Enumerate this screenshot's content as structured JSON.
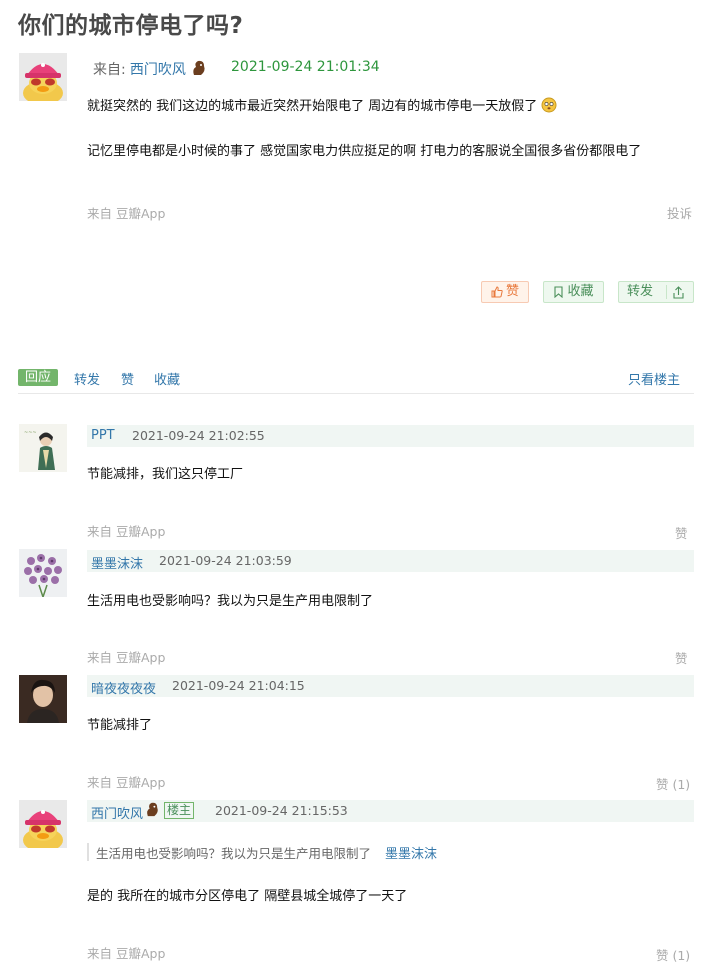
{
  "post": {
    "title": "你们的城市停电了吗?",
    "from_label": "来自:",
    "author": "西门吹风",
    "timestamp": "2021-09-24 21:01:34",
    "para1": "就挺突然的  我们这边的城市最近突然开始限电了  周边有的城市停电一天放假了",
    "para2": "记忆里停电都是小时候的事了  感觉国家电力供应挺足的啊  打电力的客服说全国很多省份都限电了",
    "source": "来自 豆瓣App",
    "report": "投诉"
  },
  "actions": {
    "like": "赞",
    "favorite": "收藏",
    "share": "转发"
  },
  "tabs": {
    "reply": "回应",
    "share": "转发",
    "like": "赞",
    "favorite": "收藏",
    "only_op": "只看楼主"
  },
  "comments": [
    {
      "name": "PPT",
      "time": "2021-09-24 21:02:55",
      "text": "节能减排，我们这只停工厂",
      "source": "来自 豆瓣App",
      "like": "赞"
    },
    {
      "name": "墨墨沫沫",
      "time": "2021-09-24 21:03:59",
      "text": "生活用电也受影响吗？我以为只是生产用电限制了",
      "source": "来自 豆瓣App",
      "like": "赞"
    },
    {
      "name": "暗夜夜夜夜",
      "time": "2021-09-24 21:04:15",
      "text": "节能减排了",
      "source": "来自 豆瓣App",
      "like": "赞 (1)"
    },
    {
      "name": "西门吹风",
      "op_badge": "楼主",
      "time": "2021-09-24 21:15:53",
      "quote_text": "生活用电也受影响吗？我以为只是生产用电限制了",
      "quote_author": "墨墨沫沫",
      "text": "是的 我所在的城市分区停电了 隔壁县城全城停了一天了",
      "source": "来自 豆瓣App",
      "like": "赞 (1)"
    }
  ],
  "colors": {
    "accent_green": "#73b56b",
    "link_blue": "#3377aa",
    "timestamp_green": "#2e963d",
    "like_orange": "#e8783c"
  }
}
